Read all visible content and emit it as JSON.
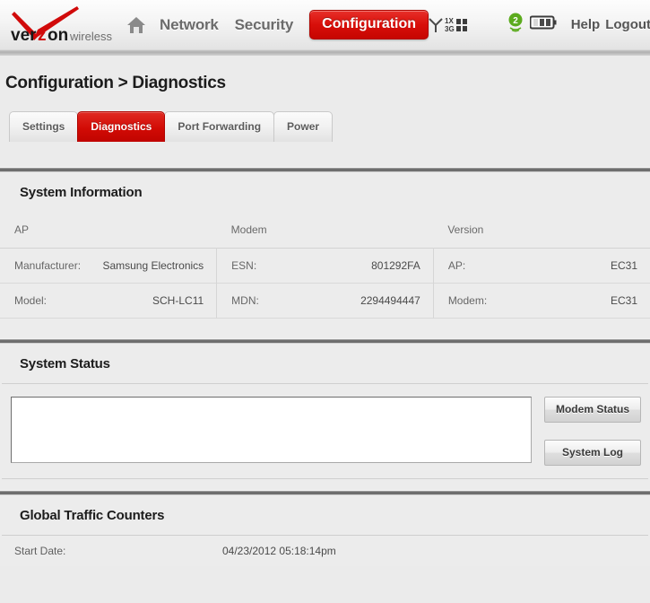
{
  "header": {
    "logo": {
      "brand": "verizon",
      "sub": "wireless",
      "accent_letter": "z"
    },
    "home_icon_name": "home-icon",
    "nav": [
      {
        "label": "Network",
        "active": false
      },
      {
        "label": "Security",
        "active": false
      },
      {
        "label": "Configuration",
        "active": true
      }
    ],
    "status": {
      "signal_label_top": "1X",
      "signal_label_bottom": "3G",
      "wifi_clients": "2",
      "help_label": "Help",
      "logout_label": "Logout"
    },
    "accent_color": "#d20b05"
  },
  "page": {
    "breadcrumb": "Configuration > Diagnostics",
    "tabs": [
      {
        "label": "Settings",
        "active": false
      },
      {
        "label": "Diagnostics",
        "active": true
      },
      {
        "label": "Port Forwarding",
        "active": false
      },
      {
        "label": "Power",
        "active": false
      }
    ]
  },
  "system_information": {
    "title": "System Information",
    "columns": [
      "AP",
      "Modem",
      "Version"
    ],
    "rows": [
      [
        {
          "key": "Manufacturer:",
          "value": "Samsung Electronics"
        },
        {
          "key": "ESN:",
          "value": "801292FA"
        },
        {
          "key": "AP:",
          "value": "EC31"
        }
      ],
      [
        {
          "key": "Model:",
          "value": "SCH-LC11"
        },
        {
          "key": "MDN:",
          "value": "2294494447"
        },
        {
          "key": "Modem:",
          "value": "EC31"
        }
      ]
    ]
  },
  "system_status": {
    "title": "System Status",
    "log_value": "",
    "log_placeholder": "",
    "buttons": [
      {
        "label": "Modem Status"
      },
      {
        "label": "System Log"
      }
    ]
  },
  "global_traffic_counters": {
    "title": "Global Traffic Counters",
    "rows": [
      {
        "label": "Start Date:",
        "value": "04/23/2012 05:18:14pm"
      }
    ]
  }
}
